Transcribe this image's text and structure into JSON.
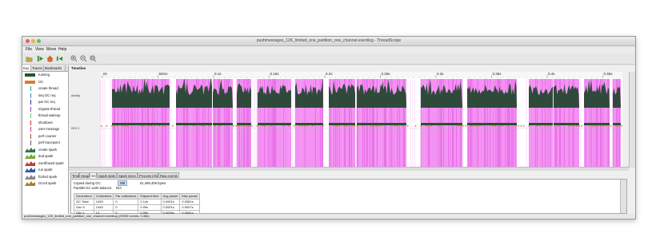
{
  "window": {
    "title": "pushmessages_12K_limited_one_partition_one_channel.eventlog - ThreadScope"
  },
  "menu": [
    "File",
    "View",
    "Move",
    "Help"
  ],
  "toolbar": {
    "icons": [
      "open-folder-icon",
      "run-icon",
      "home-icon",
      "back-icon",
      "zoom-in-icon",
      "zoom-out-icon",
      "zoom-fit-icon"
    ]
  },
  "left_tabs": [
    "Key",
    "Traces",
    "Bookmarks"
  ],
  "key_items": [
    {
      "label": "running",
      "color": "#1e5a2a",
      "style": "bar"
    },
    {
      "label": "GC",
      "color": "#e07b2a",
      "style": "bar"
    },
    {
      "label": "create thread",
      "color": "#2f9e6a",
      "style": "tick"
    },
    {
      "label": "seq GC req",
      "color": "#3a7bd5",
      "style": "tick"
    },
    {
      "label": "par GC req",
      "color": "#1d3c8e",
      "style": "tick"
    },
    {
      "label": "migrate thread",
      "color": "#9c3fc1",
      "style": "tick"
    },
    {
      "label": "thread wakeup",
      "color": "#6acb45",
      "style": "tick"
    },
    {
      "label": "shutdown",
      "color": "#c43131",
      "style": "tick"
    },
    {
      "label": "user message",
      "color": "#d92a8a",
      "style": "tick"
    },
    {
      "label": "perf counter",
      "color": "#8a5b2a",
      "style": "tick"
    },
    {
      "label": "perf tracepoint",
      "color": "#5a5a5a",
      "style": "tick"
    },
    {
      "label": "create spark",
      "color": "#2b7a3b",
      "style": "spark"
    },
    {
      "label": "dud spark",
      "color": "#7aa83a",
      "style": "spark"
    },
    {
      "label": "overflowed spark",
      "color": "#c33a3a",
      "style": "spark"
    },
    {
      "label": "run spark",
      "color": "#2f58b0",
      "style": "spark"
    },
    {
      "label": "fizzled spark",
      "color": "#8a8a8a",
      "style": "spark"
    },
    {
      "label": "GCed spark",
      "color": "#b07a2a",
      "style": "spark"
    }
  ],
  "timeline": {
    "header": "Timeline",
    "ticks": [
      "0s",
      "50ms",
      "0.1s",
      "0.15s",
      "0.2s",
      "0.25s",
      "0.3s",
      "0.35s",
      "0.4s",
      "0.45s"
    ],
    "row_labels": [
      "Activity",
      "HEC 0"
    ],
    "colors": {
      "activity": "#2f4a3a",
      "gc_fill": "#f06ef0",
      "gc_bar": "#e07b2a",
      "running": "#1e5a2a"
    }
  },
  "bottom_tabs": [
    "Time",
    "Heap",
    "GC",
    "Spark stats",
    "Spark sizes",
    "Process info",
    "Raw events"
  ],
  "gc_stats": {
    "copied_label": "Copied during GC:",
    "copied_unit": "MB",
    "copied_value": "61,496,408 bytes",
    "balance_label": "Parallel GC work balance:",
    "balance_value": "N/A",
    "headers": [
      "Generation",
      "Collections",
      "Par collections",
      "Elapsed time",
      "Avg pause",
      "Max pause"
    ],
    "rows": [
      [
        "GC Total",
        "1459",
        "0",
        "0.14s",
        "0.0001s",
        "0.0081s"
      ],
      [
        "Gen 0",
        "1445",
        "0",
        "0.09s",
        "0.0001s",
        "0.0007s"
      ],
      [
        "Gen 1",
        "14",
        "0",
        "0.05s",
        "0.0035s",
        "0.0081s"
      ]
    ]
  },
  "status": "pushmessages_12K_limited_one_partition_one_channel.eventlog (20935 events, 0.48s)"
}
